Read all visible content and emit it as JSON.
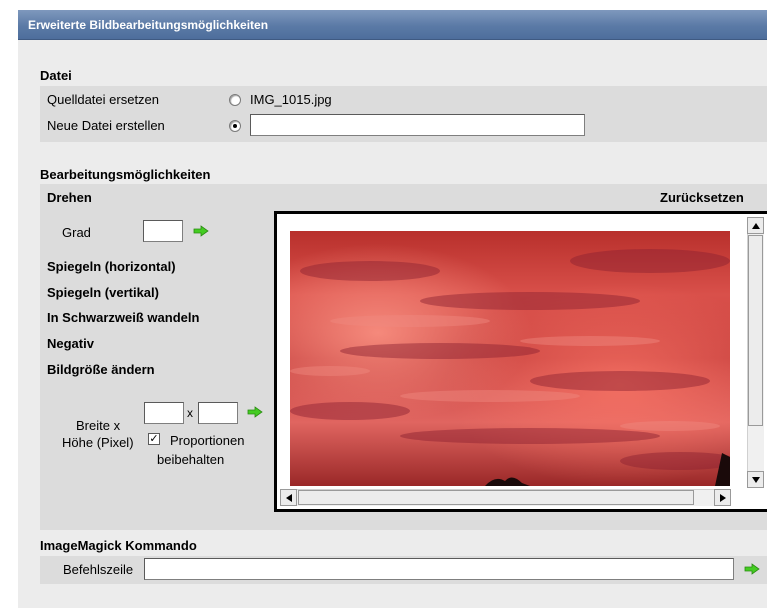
{
  "title": "Erweiterte Bildbearbeitungsmöglichkeiten",
  "datei": {
    "heading": "Datei",
    "replace_label": "Quelldatei ersetzen",
    "replace_filename": "IMG_1015.jpg",
    "new_label": "Neue Datei erstellen",
    "new_value": "",
    "selected": "new"
  },
  "options": {
    "heading": "Bearbeitungsmöglichkeiten",
    "rotate": "Drehen",
    "reset": "Zurücksetzen",
    "degree_label": "Grad",
    "degree_value": "",
    "flip_h": "Spiegeln (horizontal)",
    "flip_v": "Spiegeln (vertikal)",
    "grayscale": "In Schwarzweiß wandeln",
    "negative": "Negativ",
    "resize": "Bildgröße ändern",
    "width_height_label_1": "Breite x",
    "width_height_label_2": "Höhe (Pixel)",
    "times": "x",
    "width_value": "",
    "height_value": "",
    "keep_ratio_1": "Proportionen",
    "keep_ratio_2": "beibehalten",
    "keep_ratio_checked": true
  },
  "imagemagick": {
    "heading": "ImageMagick Kommando",
    "cmd_label": "Befehlszeile",
    "cmd_value": ""
  },
  "colors": {
    "accent_arrow": "#44cc22",
    "titlebar": "#5b7aa6"
  }
}
